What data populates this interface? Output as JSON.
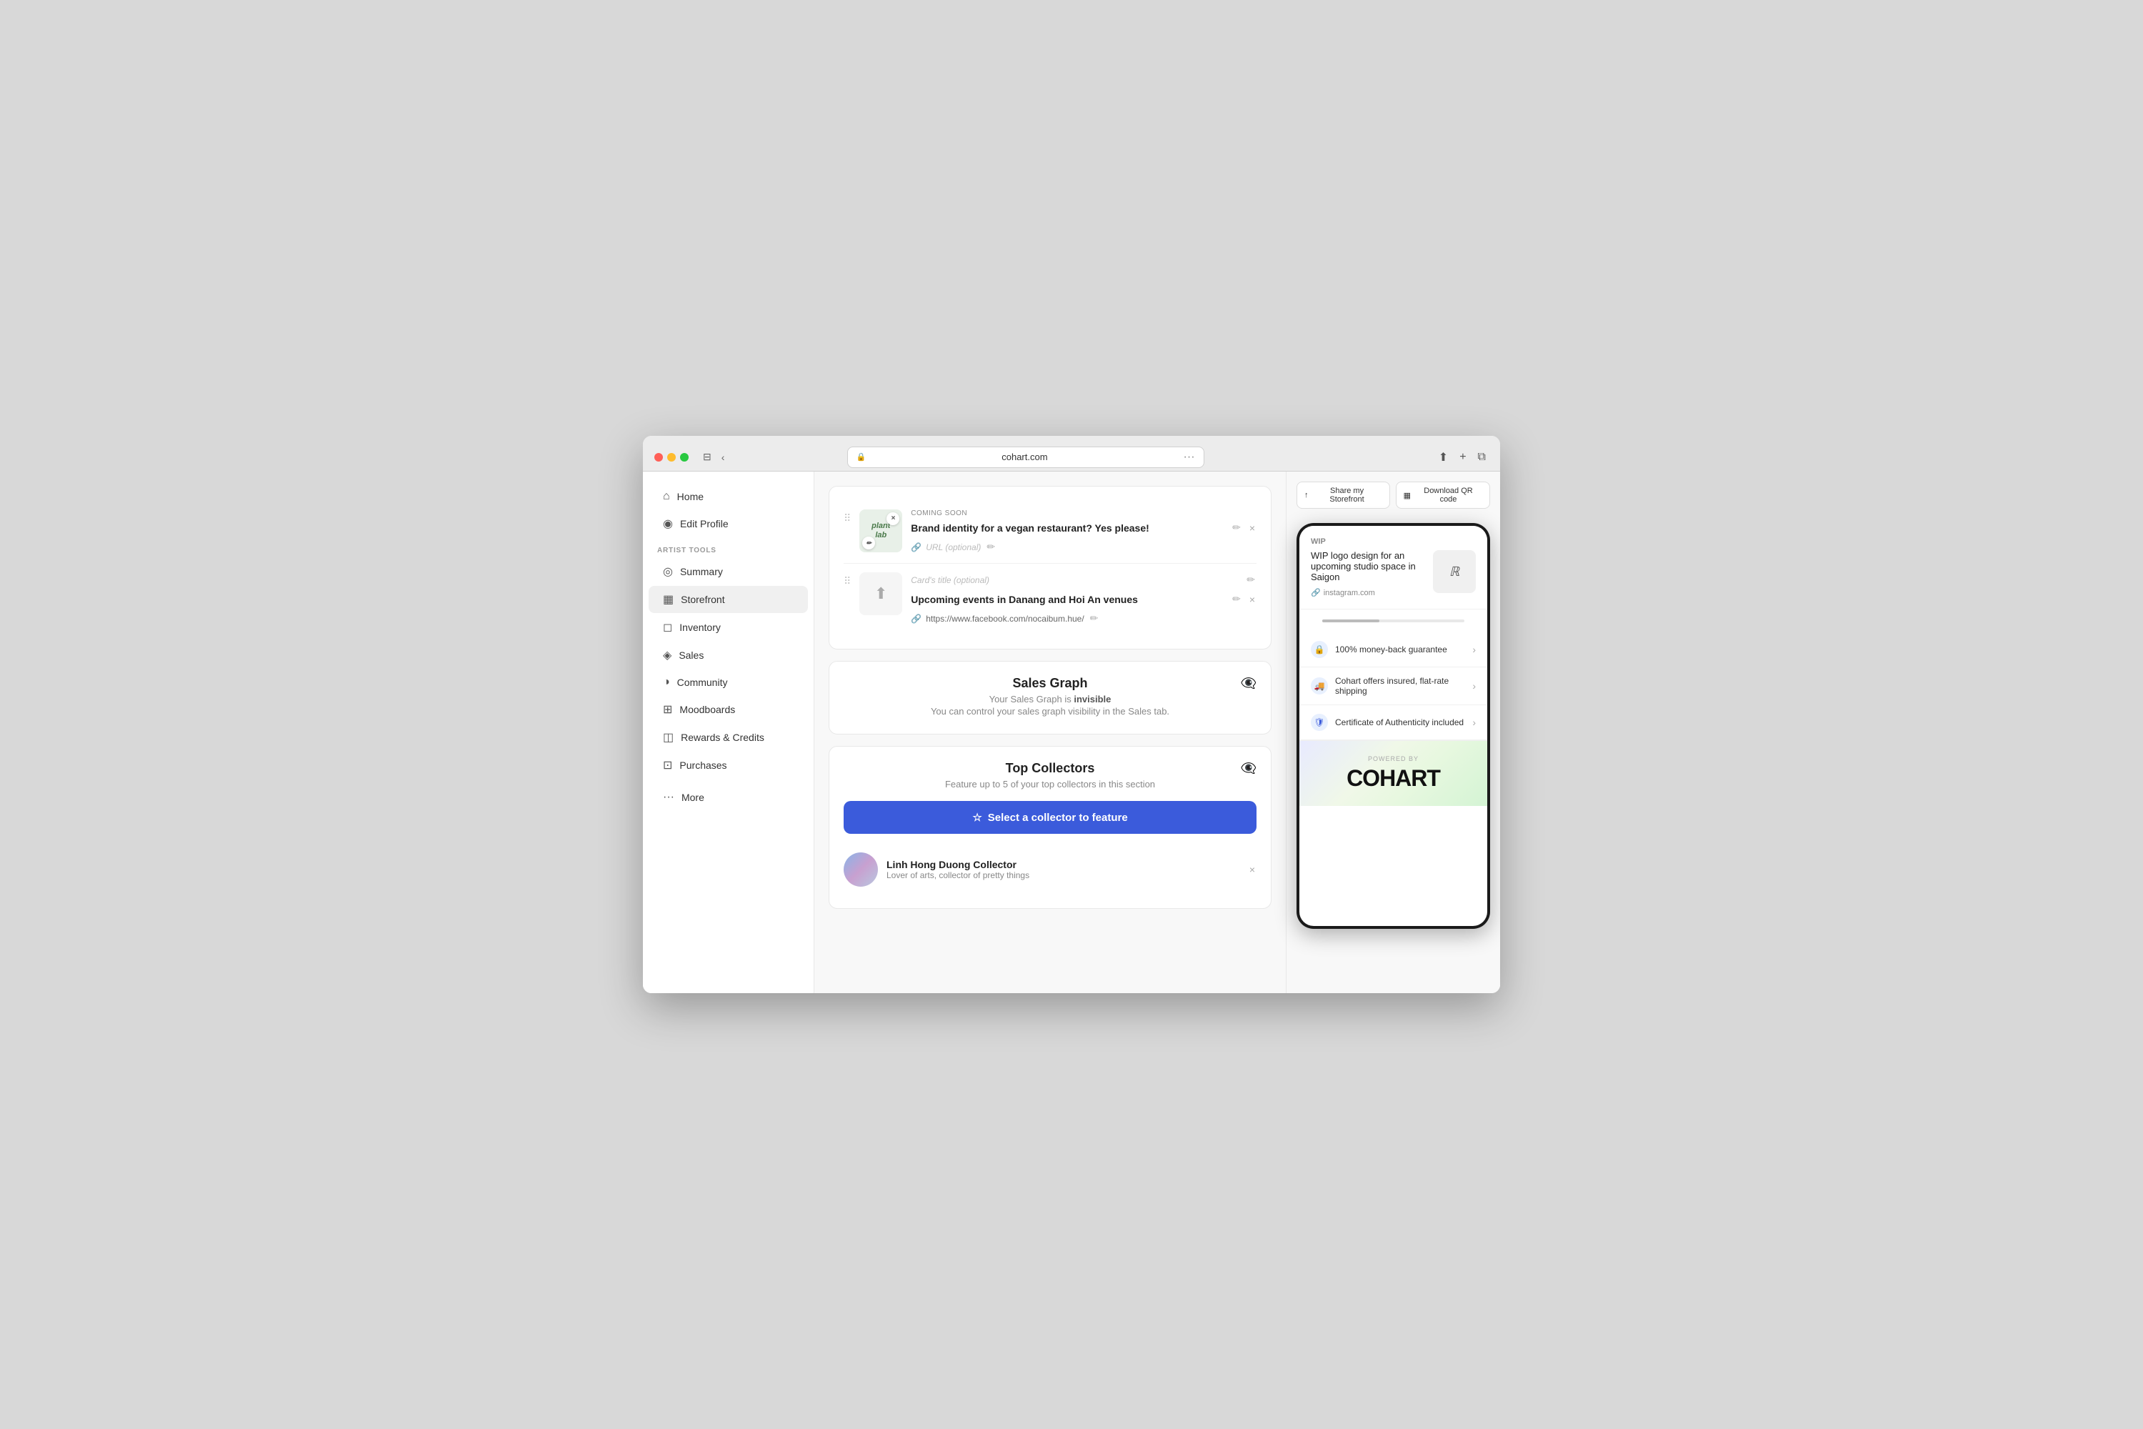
{
  "browser": {
    "address": "cohart.com",
    "lock_icon": "🔒",
    "more_icon": "···"
  },
  "header_actions": {
    "share_label": "Share my Storefront",
    "qr_label": "Download QR code",
    "share_icon": "↑",
    "qr_icon": "▦"
  },
  "sidebar": {
    "section_label": "ARTIST TOOLS",
    "items": [
      {
        "id": "home",
        "label": "Home",
        "icon": "⌂"
      },
      {
        "id": "edit-profile",
        "label": "Edit Profile",
        "icon": "◉"
      },
      {
        "id": "summary",
        "label": "Summary",
        "icon": "◎"
      },
      {
        "id": "storefront",
        "label": "Storefront",
        "icon": "▦",
        "active": true
      },
      {
        "id": "inventory",
        "label": "Inventory",
        "icon": "◻"
      },
      {
        "id": "sales",
        "label": "Sales",
        "icon": "◈"
      },
      {
        "id": "community",
        "label": "Community",
        "icon": "◑"
      },
      {
        "id": "moodboards",
        "label": "Moodboards",
        "icon": "⊞"
      },
      {
        "id": "rewards",
        "label": "Rewards & Credits",
        "icon": "◫"
      },
      {
        "id": "purchases",
        "label": "Purchases",
        "icon": "⊡"
      }
    ],
    "more_label": "More"
  },
  "cards": {
    "coming_soon": {
      "tag": "COMING SOON",
      "item1": {
        "title": "Brand identity for a vegan restaurant? Yes please!",
        "url_placeholder": "URL (optional)"
      },
      "item2": {
        "title_placeholder": "Card's title (optional)",
        "title": "Upcoming events in Danang and Hoi An venues",
        "url": "https://www.facebook.com/nocaibum.hue/"
      }
    },
    "sales_graph": {
      "title": "Sales Graph",
      "subtitle": "Your Sales Graph is",
      "subtitle_status": "invisible",
      "subtitle_after": "",
      "description": "You can control your sales graph visibility in the Sales tab."
    },
    "top_collectors": {
      "title": "Top Collectors",
      "subtitle": "Feature up to 5 of your top collectors in this section",
      "select_btn_label": "Select a collector to feature",
      "collector": {
        "name": "Linh Hong Duong Collector",
        "bio": "Lover of arts, collector of pretty things"
      }
    }
  },
  "preview": {
    "wip": {
      "badge": "WIP",
      "title": "WIP logo design for an upcoming studio space in Saigon",
      "link": "instagram.com",
      "link_icon": "🔗"
    },
    "accordion": [
      {
        "icon": "🔒",
        "text": "100% money-back guarantee"
      },
      {
        "icon": "🚚",
        "text": "Cohart offers insured, flat-rate shipping"
      },
      {
        "icon": "🛡",
        "text": "Certificate of Authenticity included"
      }
    ],
    "powered_by": "POWERED BY",
    "brand": "COHART"
  }
}
